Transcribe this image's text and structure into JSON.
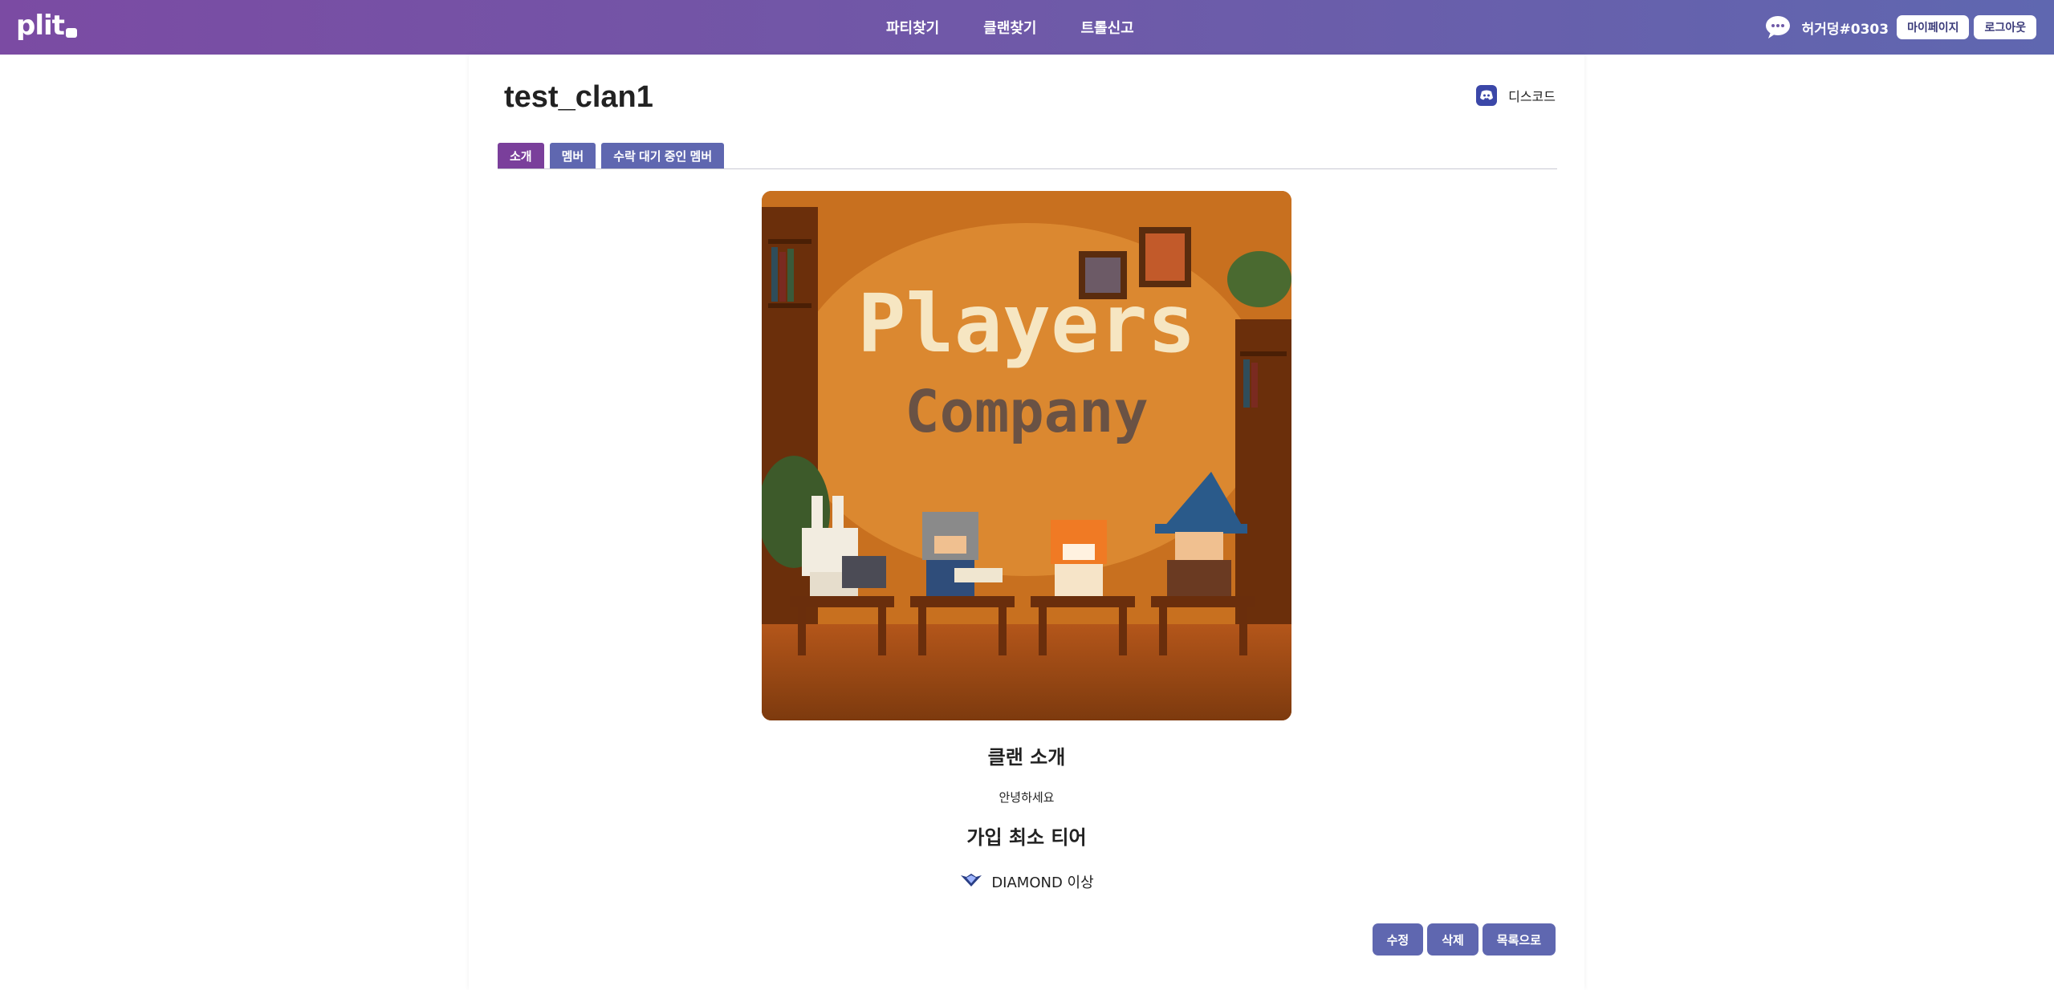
{
  "header": {
    "logo_text": "plit",
    "nav": [
      {
        "label": "파티찾기"
      },
      {
        "label": "클랜찾기"
      },
      {
        "label": "트롤신고"
      }
    ],
    "username": "허거덩#0303",
    "mypage_label": "마이페이지",
    "logout_label": "로그아웃",
    "chat_icon": "chat-bubble-icon"
  },
  "clan": {
    "name": "test_clan1",
    "discord_label": "디스코드",
    "discord_icon": "discord-icon",
    "tabs": [
      {
        "label": "소개",
        "active": true
      },
      {
        "label": "멤버",
        "active": false
      },
      {
        "label": "수락 대기 중인 멤버",
        "active": false
      }
    ],
    "image": {
      "line1": "Players",
      "line2": "Company"
    },
    "intro_title": "클랜 소개",
    "intro_text": "안녕하세요",
    "tier_title": "가입 최소 티어",
    "tier_value": "DIAMOND 이상",
    "tier_icon": "diamond-tier-icon"
  },
  "actions": {
    "edit_label": "수정",
    "delete_label": "삭제",
    "list_label": "목록으로"
  },
  "colors": {
    "header_start": "#7b4ba3",
    "header_end": "#5f67b0",
    "tab_active": "#7a3f9b",
    "button": "#5f67b0"
  }
}
